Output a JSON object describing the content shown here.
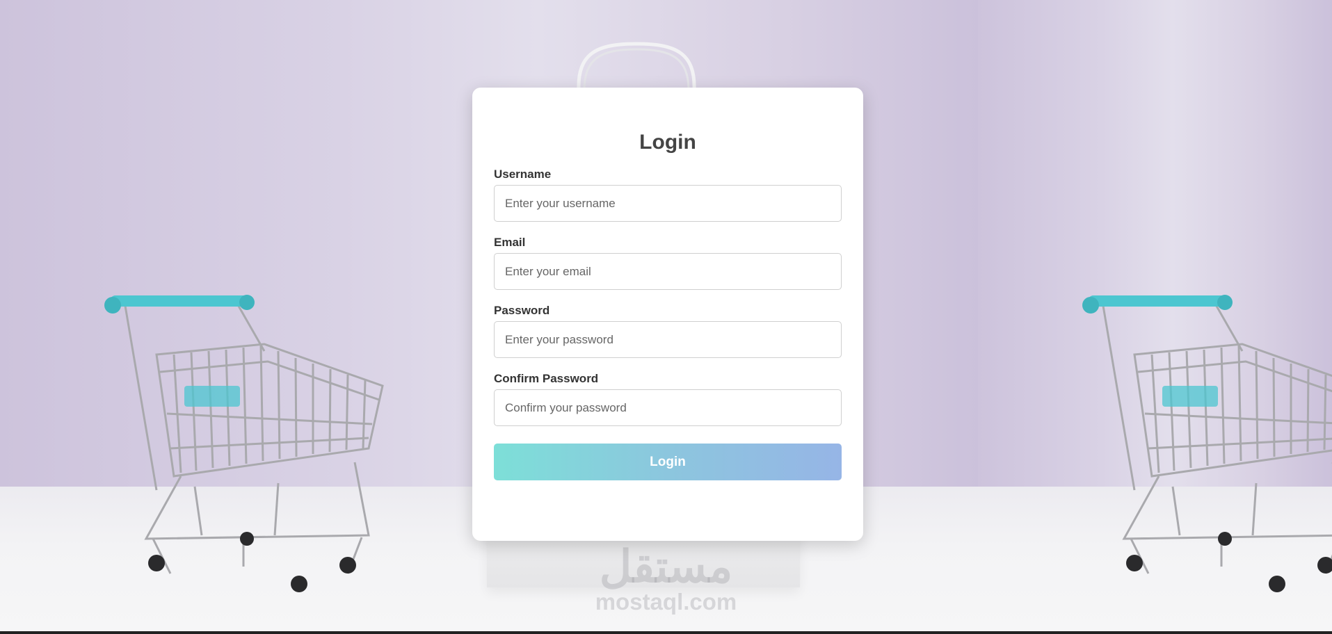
{
  "form": {
    "title": "Login",
    "fields": [
      {
        "label": "Username",
        "placeholder": "Enter your username",
        "type": "text"
      },
      {
        "label": "Email",
        "placeholder": "Enter your email",
        "type": "email"
      },
      {
        "label": "Password",
        "placeholder": "Enter your password",
        "type": "password"
      },
      {
        "label": "Confirm Password",
        "placeholder": "Confirm your password",
        "type": "password"
      }
    ],
    "submit_label": "Login"
  },
  "watermark": {
    "arabic": "مستقل",
    "latin": "mostaql.com"
  },
  "colors": {
    "button_gradient_start": "#7ddfd8",
    "button_gradient_end": "#96b5e6",
    "cart_handle": "#4cc6d0",
    "wall": "#d9d2e5"
  },
  "icons": {
    "background_object_1": "shopping-cart-icon",
    "background_object_2": "shopping-bag-icon"
  }
}
